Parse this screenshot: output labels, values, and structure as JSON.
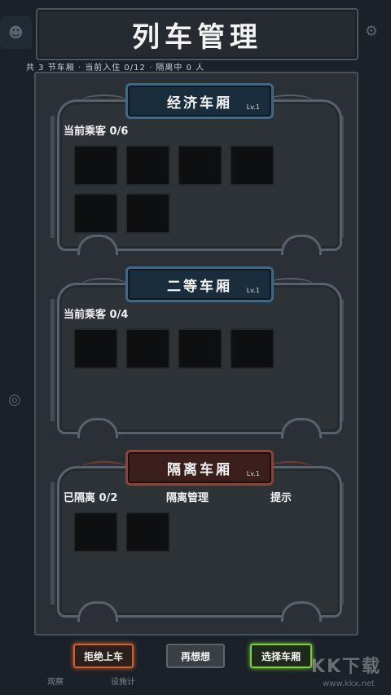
{
  "title": "列车管理",
  "summary": "共 3 节车厢 · 当前入住 0/12 · 隔离中 0 人",
  "cars": [
    {
      "name": "经济车厢",
      "level": "Lv.1",
      "occupancy_label": "当前乘客 0/6",
      "slot_count": 6,
      "plate": "blue"
    },
    {
      "name": "二等车厢",
      "level": "Lv.1",
      "occupancy_label": "当前乘客 0/4",
      "slot_count": 4,
      "plate": "blue"
    },
    {
      "name": "隔离车厢",
      "level": "Lv.1",
      "occupancy_label": "已隔离 0/2",
      "manage_label": "隔离管理",
      "hint_label": "提示",
      "slot_count": 2,
      "plate": "red"
    }
  ],
  "buttons": {
    "reject": "拒绝上车",
    "rethink": "再想想",
    "choose": "选择车厢"
  },
  "bottom_tabs": [
    "观察",
    "设施计"
  ],
  "watermark": {
    "text": "KK下载",
    "url": "www.kkx.net"
  },
  "colors": {
    "reject_border": "#d1602e",
    "choose_border": "#7ccf3e",
    "plate_blue": "#3e6988",
    "plate_red": "#8a4438"
  }
}
